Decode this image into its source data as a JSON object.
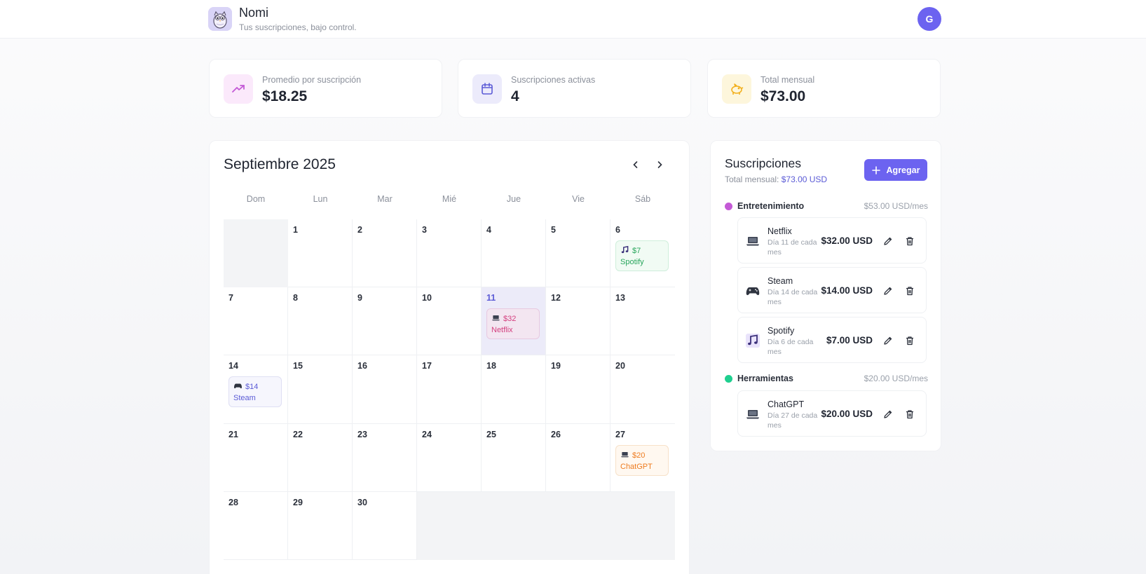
{
  "header": {
    "app_name": "Nomi",
    "tagline": "Tus suscripciones, bajo control.",
    "avatar_initial": "G"
  },
  "stats": [
    {
      "label": "Promedio por suscripción",
      "value": "$18.25",
      "icon": "trending-up-icon",
      "color": "#c45ad6"
    },
    {
      "label": "Suscripciones activas",
      "value": "4",
      "icon": "calendar-icon",
      "color": "#5b5bd6"
    },
    {
      "label": "Total mensual",
      "value": "$73.00",
      "icon": "piggy-bank-icon",
      "color": "#f2b01e"
    }
  ],
  "calendar": {
    "title": "Septiembre 2025",
    "weekdays": [
      "Dom",
      "Lun",
      "Mar",
      "Mié",
      "Jue",
      "Vie",
      "Sáb"
    ],
    "today": 11,
    "days": [
      {
        "day": ""
      },
      {
        "day": "1"
      },
      {
        "day": "2"
      },
      {
        "day": "3"
      },
      {
        "day": "4"
      },
      {
        "day": "5"
      },
      {
        "day": "6",
        "event": {
          "amount": "$7",
          "name": "Spotify",
          "icon": "music-note-icon",
          "style": "green"
        }
      },
      {
        "day": "7"
      },
      {
        "day": "8"
      },
      {
        "day": "9"
      },
      {
        "day": "10"
      },
      {
        "day": "11",
        "event": {
          "amount": "$32",
          "name": "Netflix",
          "icon": "laptop-icon",
          "style": "pink"
        }
      },
      {
        "day": "12"
      },
      {
        "day": "13"
      },
      {
        "day": "14",
        "event": {
          "amount": "$14",
          "name": "Steam",
          "icon": "gamepad-icon",
          "style": "indigo"
        }
      },
      {
        "day": "15"
      },
      {
        "day": "16"
      },
      {
        "day": "17"
      },
      {
        "day": "18"
      },
      {
        "day": "19"
      },
      {
        "day": "20"
      },
      {
        "day": "21"
      },
      {
        "day": "22"
      },
      {
        "day": "23"
      },
      {
        "day": "24"
      },
      {
        "day": "25"
      },
      {
        "day": "26"
      },
      {
        "day": "27",
        "event": {
          "amount": "$20",
          "name": "ChatGPT",
          "icon": "laptop-icon",
          "style": "orange"
        }
      },
      {
        "day": "28"
      },
      {
        "day": "29"
      },
      {
        "day": "30"
      },
      {
        "day": ""
      },
      {
        "day": ""
      },
      {
        "day": ""
      },
      {
        "day": ""
      }
    ]
  },
  "subscriptions": {
    "title": "Suscripciones",
    "total_label": "Total mensual:",
    "total_value": "$73.00 USD",
    "add_label": "Agregar",
    "categories": [
      {
        "name": "Entretenimiento",
        "total": "$53.00 USD/mes",
        "color": "#c45ad6",
        "items": [
          {
            "name": "Netflix",
            "desc": "Día 11 de cada mes",
            "price": "$32.00 USD",
            "icon": "laptop-icon"
          },
          {
            "name": "Steam",
            "desc": "Día 14 de cada mes",
            "price": "$14.00 USD",
            "icon": "gamepad-icon"
          },
          {
            "name": "Spotify",
            "desc": "Día 6 de cada mes",
            "price": "$7.00 USD",
            "icon": "music-note-icon"
          }
        ]
      },
      {
        "name": "Herramientas",
        "total": "$20.00 USD/mes",
        "color": "#1fcf8f",
        "items": [
          {
            "name": "ChatGPT",
            "desc": "Día 27 de cada mes",
            "price": "$20.00 USD",
            "icon": "laptop-icon"
          }
        ]
      }
    ]
  }
}
